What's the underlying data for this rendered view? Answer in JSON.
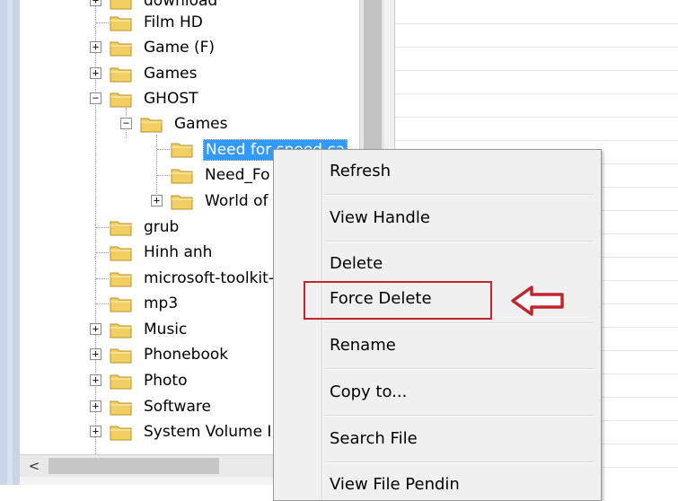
{
  "tree": {
    "items": [
      {
        "label": "download",
        "expander": "plus"
      },
      {
        "label": "Film HD",
        "expander": ""
      },
      {
        "label": "Game (F)",
        "expander": "plus"
      },
      {
        "label": "Games",
        "expander": "plus"
      },
      {
        "label": "GHOST",
        "expander": "minus"
      },
      {
        "label": "Games",
        "expander": "minus"
      },
      {
        "label": "Need for speed ca",
        "expander": "",
        "selected": true
      },
      {
        "label": "Need_Fo",
        "expander": ""
      },
      {
        "label": "World of",
        "expander": "plus"
      },
      {
        "label": "grub",
        "expander": ""
      },
      {
        "label": "Hinh anh",
        "expander": ""
      },
      {
        "label": "microsoft-toolkit-",
        "expander": ""
      },
      {
        "label": "mp3",
        "expander": ""
      },
      {
        "label": "Music",
        "expander": "plus"
      },
      {
        "label": "Phonebook",
        "expander": "plus"
      },
      {
        "label": "Photo",
        "expander": "plus"
      },
      {
        "label": "Software",
        "expander": "plus"
      },
      {
        "label": "System Volume I",
        "expander": "plus"
      }
    ]
  },
  "context_menu": {
    "items": [
      {
        "label": "Refresh"
      },
      {
        "label": "View Handle"
      },
      {
        "label": "Delete"
      },
      {
        "label": "Force Delete",
        "highlighted": true
      },
      {
        "label": "Rename"
      },
      {
        "label": "Copy to..."
      },
      {
        "label": "Search File"
      },
      {
        "label": "View File Pendin"
      }
    ]
  },
  "annotation": {
    "box_color": "#c0262d",
    "arrow_color": "#c0262d",
    "arrow_icon": "left-arrow-icon"
  },
  "scrollbar": {
    "left_arrow": "<"
  },
  "colors": {
    "selection": "#3399ff",
    "folder": "#f2cf62"
  }
}
